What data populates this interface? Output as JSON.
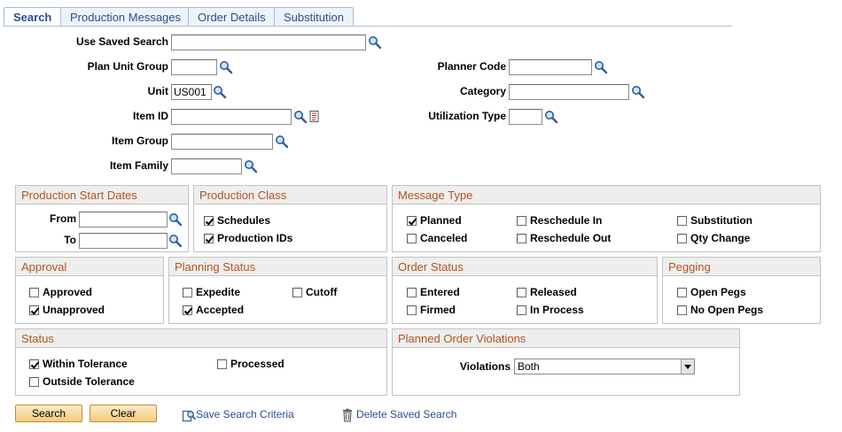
{
  "tabs": [
    "Search",
    "Production Messages",
    "Order Details",
    "Substitution"
  ],
  "fields": {
    "use_saved_search": {
      "label": "Use Saved Search",
      "value": ""
    },
    "plan_unit_group": {
      "label": "Plan Unit Group",
      "value": ""
    },
    "unit": {
      "label": "Unit",
      "value": "US001"
    },
    "item_id": {
      "label": "Item ID",
      "value": ""
    },
    "item_group": {
      "label": "Item Group",
      "value": ""
    },
    "item_family": {
      "label": "Item Family",
      "value": ""
    },
    "planner_code": {
      "label": "Planner Code",
      "value": ""
    },
    "category": {
      "label": "Category",
      "value": ""
    },
    "utilization_type": {
      "label": "Utilization Type",
      "value": ""
    }
  },
  "groups": {
    "production_start_dates": {
      "title": "Production Start Dates",
      "from": "From",
      "to": "To"
    },
    "production_class": {
      "title": "Production Class",
      "items": [
        {
          "label": "Schedules",
          "checked": true
        },
        {
          "label": "Production IDs",
          "checked": true
        }
      ]
    },
    "message_type": {
      "title": "Message Type",
      "items": [
        {
          "label": "Planned",
          "checked": true
        },
        {
          "label": "Reschedule In",
          "checked": false
        },
        {
          "label": "Substitution",
          "checked": false
        },
        {
          "label": "Canceled",
          "checked": false
        },
        {
          "label": "Reschedule Out",
          "checked": false
        },
        {
          "label": "Qty Change",
          "checked": false
        }
      ]
    },
    "approval": {
      "title": "Approval",
      "items": [
        {
          "label": "Approved",
          "checked": false
        },
        {
          "label": "Unapproved",
          "checked": true
        }
      ]
    },
    "planning_status": {
      "title": "Planning Status",
      "items": [
        {
          "label": "Expedite",
          "checked": false
        },
        {
          "label": "Cutoff",
          "checked": false
        },
        {
          "label": "Accepted",
          "checked": true
        }
      ]
    },
    "order_status": {
      "title": "Order Status",
      "items": [
        {
          "label": "Entered",
          "checked": false
        },
        {
          "label": "Released",
          "checked": false
        },
        {
          "label": "Firmed",
          "checked": false
        },
        {
          "label": "In Process",
          "checked": false
        }
      ]
    },
    "pegging": {
      "title": "Pegging",
      "items": [
        {
          "label": "Open Pegs",
          "checked": false
        },
        {
          "label": "No Open Pegs",
          "checked": false
        }
      ]
    },
    "status": {
      "title": "Status",
      "items": [
        {
          "label": "Within Tolerance",
          "checked": true
        },
        {
          "label": "Processed",
          "checked": false
        },
        {
          "label": "Outside Tolerance",
          "checked": false
        }
      ]
    },
    "violations": {
      "title": "Planned Order Violations",
      "label": "Violations",
      "value": "Both"
    }
  },
  "buttons": {
    "search": "Search",
    "clear": "Clear"
  },
  "links": {
    "save": "Save Search Criteria",
    "delete": "Delete Saved Search"
  }
}
